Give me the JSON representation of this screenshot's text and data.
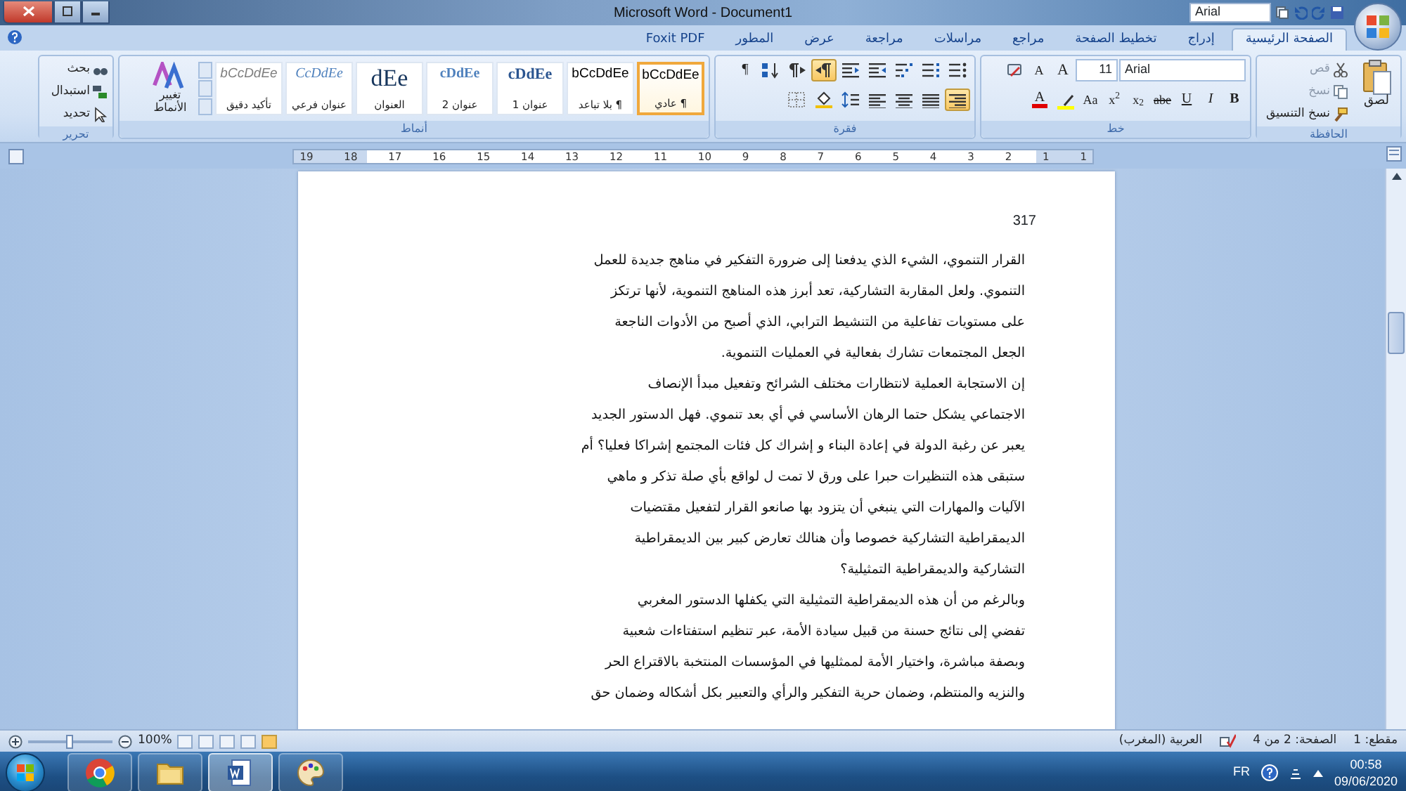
{
  "title_bar": {
    "title": "Microsoft Word - Document1",
    "font_box": "Arial"
  },
  "tabs": [
    {
      "label": "الصفحة الرئيسية",
      "selected": true
    },
    {
      "label": "إدراج",
      "selected": false
    },
    {
      "label": "تخطيط الصفحة",
      "selected": false
    },
    {
      "label": "مراجع",
      "selected": false
    },
    {
      "label": "مراسلات",
      "selected": false
    },
    {
      "label": "مراجعة",
      "selected": false
    },
    {
      "label": "عرض",
      "selected": false
    },
    {
      "label": "المطور",
      "selected": false
    },
    {
      "label": "Foxit PDF",
      "selected": false
    }
  ],
  "ribbon": {
    "clipboard": {
      "label": "الحافظة",
      "paste": "لصق",
      "items": [
        {
          "kind": "cut",
          "label": "قص",
          "disabled": true
        },
        {
          "kind": "copy",
          "label": "نسخ",
          "disabled": true
        },
        {
          "kind": "format-painter",
          "label": "نسخ التنسيق",
          "disabled": false
        }
      ]
    },
    "font": {
      "label": "خط",
      "font": "Arial",
      "size": "11",
      "grow": "A",
      "shrink": "A",
      "buttons": [
        {
          "kind": "bold",
          "label": "B"
        },
        {
          "kind": "italic",
          "label": "I"
        },
        {
          "kind": "underline",
          "label": "U"
        },
        {
          "kind": "strike",
          "label": "abe"
        },
        {
          "kind": "subscript",
          "label": "x$_{2}$"
        },
        {
          "kind": "superscript",
          "label": "x$^{2}$"
        },
        {
          "kind": "case",
          "label": "Aa"
        },
        {
          "kind": "highlight"
        },
        {
          "kind": "font-color",
          "label": "A"
        }
      ]
    },
    "paragraph": {
      "label": "فقرة",
      "row1": [
        {
          "kind": "bullets",
          "active": false
        },
        {
          "kind": "numbering",
          "active": false
        },
        {
          "kind": "multilevel",
          "active": false
        },
        {
          "kind": "indent-decrease",
          "active": false
        },
        {
          "kind": "indent-increase",
          "active": false
        },
        {
          "kind": "rtl",
          "active": true
        },
        {
          "kind": "ltr",
          "active": false
        },
        {
          "kind": "sort",
          "active": false
        },
        {
          "kind": "marks",
          "active": false,
          "label": "¶"
        }
      ],
      "row2": [
        {
          "kind": "align-right",
          "active": true
        },
        {
          "kind": "align-justify",
          "active": false
        },
        {
          "kind": "align-center",
          "active": false
        },
        {
          "kind": "align-left",
          "active": false
        },
        {
          "kind": "line-spacing",
          "active": false
        },
        {
          "kind": "shading",
          "active": false
        },
        {
          "kind": "borders",
          "active": false
        }
      ]
    },
    "styles": {
      "label": "أنماط",
      "change": "تغيير الأنماط",
      "items": [
        {
          "kind": "normal",
          "preview": "bCcDdEe",
          "name": "¶ عادي",
          "selected": true
        },
        {
          "kind": "normal",
          "preview": "bCcDdEe",
          "name": "¶ بلا تباعد",
          "selected": false
        },
        {
          "kind": "heading1",
          "preview": "cDdEe",
          "name": "عنوان 1",
          "selected": false
        },
        {
          "kind": "heading2",
          "preview": "cDdEe",
          "name": "عنوان 2",
          "selected": false
        },
        {
          "kind": "title",
          "preview": "dEe",
          "name": "العنوان",
          "selected": false
        },
        {
          "kind": "subtitle",
          "preview": "CcDdEe",
          "name": "عنوان فرعي",
          "selected": false
        },
        {
          "kind": "emphasis",
          "preview": "bCcDdEe",
          "name": "تأكيد دقيق",
          "selected": false
        }
      ]
    },
    "editing": {
      "label": "تحرير",
      "items": [
        {
          "kind": "find",
          "label": "بحث"
        },
        {
          "kind": "replace",
          "label": "استبدال"
        },
        {
          "kind": "select",
          "label": "تحديد"
        }
      ]
    }
  },
  "ruler": [
    "1",
    "1",
    "2",
    "3",
    "4",
    "5",
    "6",
    "7",
    "8",
    "9",
    "10",
    "11",
    "12",
    "13",
    "14",
    "15",
    "16",
    "17",
    "18",
    "19"
  ],
  "document": {
    "page_number": "317",
    "lines": [
      "القرار التنموي، الشيء الذي يدفعنا إلى ضرورة التفكير في مناهج جديدة للعمل",
      "التنموي. ولعل المقاربة التشاركية، تعد أبرز هذه المناهج التنموية، لأنها ترتكز",
      "على مستويات تفاعلية من التنشيط الترابي، الذي أصبح من الأدوات الناجعة",
      "الجعل المجتمعات تشارك بفعالية في العمليات التنموية.",
      "إن الاستجابة العملية لانتظارات مختلف الشرائح وتفعيل مبدأ الإنصاف",
      "الاجتماعي يشكل حتما الرهان الأساسي في أي بعد تنموي. فهل الدستور الجديد",
      "يعبر عن رغبة الدولة في إعادة البناء و إشراك كل فئات المجتمع إشراكا فعليا؟ أم",
      "ستبقى هذه التنظيرات حبرا على ورق لا تمت ل لواقع بأي صلة تذكر و ماهي",
      "الآليات والمهارات التي ينبغي أن يتزود بها صانعو القرار لتفعيل مقتضيات",
      "الديمقراطية التشاركية خصوصا وأن هنالك تعارض كبير بين الديمقراطية",
      "التشاركية والديمقراطية التمثيلية؟",
      "وبالرغم من أن هذه الديمقراطية التمثيلية التي يكفلها الدستور المغربي",
      "تفضي إلى نتائج حسنة من قبيل سيادة الأمة، عبر تنظيم استفتاءات شعبية",
      "وبصفة مباشرة، واختيار الأمة لممثليها في المؤسسات المنتخبة بالاقتراع الحر",
      "والنزيه والمنتظم، وضمان حرية التفكير والرأي والتعبير بكل أشكاله وضمان حق"
    ]
  },
  "status_bar": {
    "items": [
      "مقطع: 1",
      "الصفحة: 2 من 4",
      "العربية (المغرب)"
    ],
    "zoom": "100%",
    "zoom_slider": {
      "level": 0.5
    },
    "views": [
      {
        "selected": true
      },
      {
        "selected": false
      },
      {
        "selected": false
      },
      {
        "selected": false
      },
      {
        "selected": false
      }
    ]
  },
  "taskbar": {
    "apps": [
      {
        "kind": "chrome",
        "active": false
      },
      {
        "kind": "folder",
        "active": false
      },
      {
        "kind": "word",
        "active": true
      },
      {
        "kind": "paint",
        "active": false
      }
    ],
    "language": "FR",
    "time": "00:58",
    "date": "09/06/2020"
  }
}
